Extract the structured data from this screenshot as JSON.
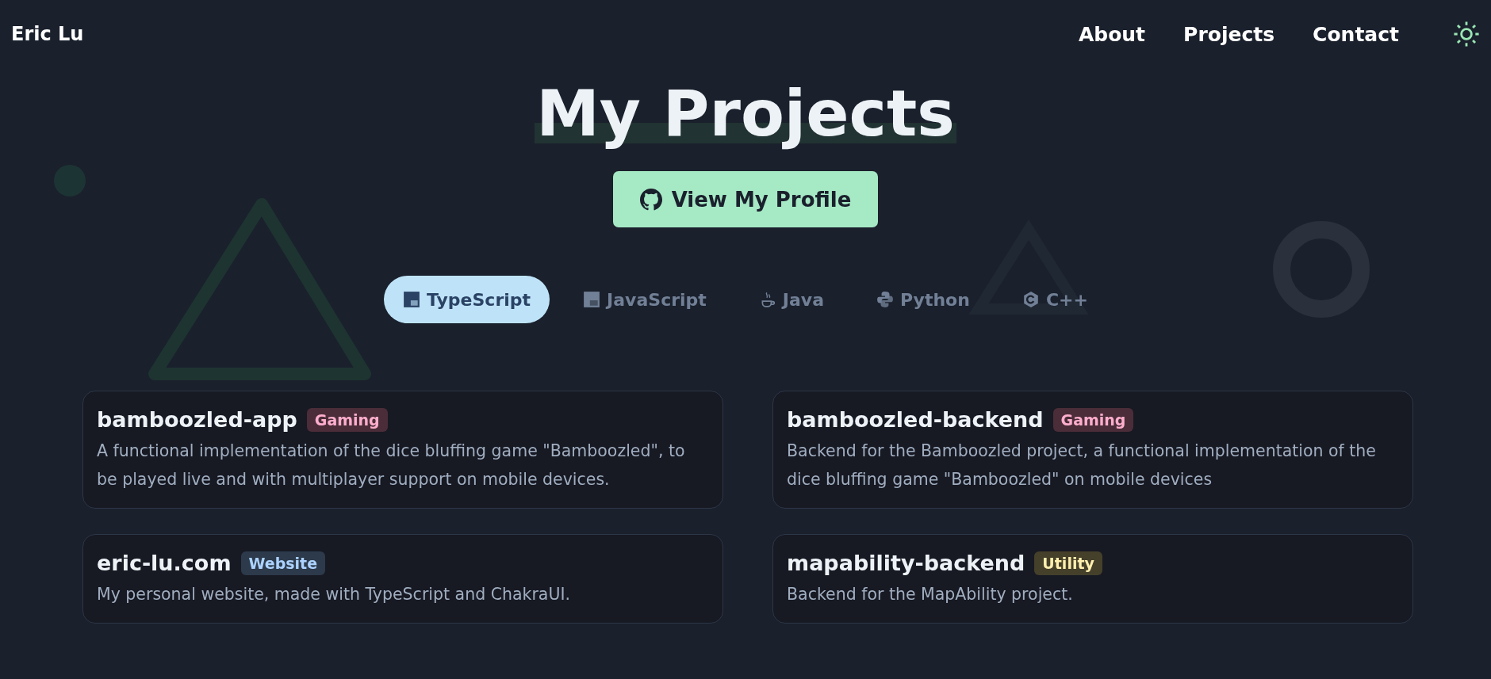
{
  "header": {
    "brand": "Eric Lu",
    "nav": [
      "About",
      "Projects",
      "Contact"
    ]
  },
  "title": "My Projects",
  "profile_button": "View My Profile",
  "tabs": [
    {
      "label": "TypeScript",
      "kind": "ts",
      "selected": true
    },
    {
      "label": "JavaScript",
      "kind": "js",
      "selected": false
    },
    {
      "label": "Java",
      "kind": "java",
      "selected": false
    },
    {
      "label": "Python",
      "kind": "python",
      "selected": false
    },
    {
      "label": "C++",
      "kind": "cpp",
      "selected": false
    }
  ],
  "projects": [
    {
      "name": "bamboozled-app",
      "tag": "Gaming",
      "color": "#4a2d38",
      "description": "A functional implementation of the dice bluffing game \"Bamboozled\", to be played live and with multiplayer support on mobile devices."
    },
    {
      "name": "bamboozled-backend",
      "tag": "Gaming",
      "color": "#4a2d38",
      "description": "Backend for the Bamboozled project, a functional implementation of the dice bluffing game \"Bamboozled\" on mobile devices"
    },
    {
      "name": "eric-lu.com",
      "tag": "Website",
      "color": "#2c3a4b",
      "description": "My personal website, made with TypeScript and ChakraUI."
    },
    {
      "name": "mapability-backend",
      "tag": "Utility",
      "color": "#45402a",
      "description": "Backend for the MapAbility project."
    }
  ]
}
